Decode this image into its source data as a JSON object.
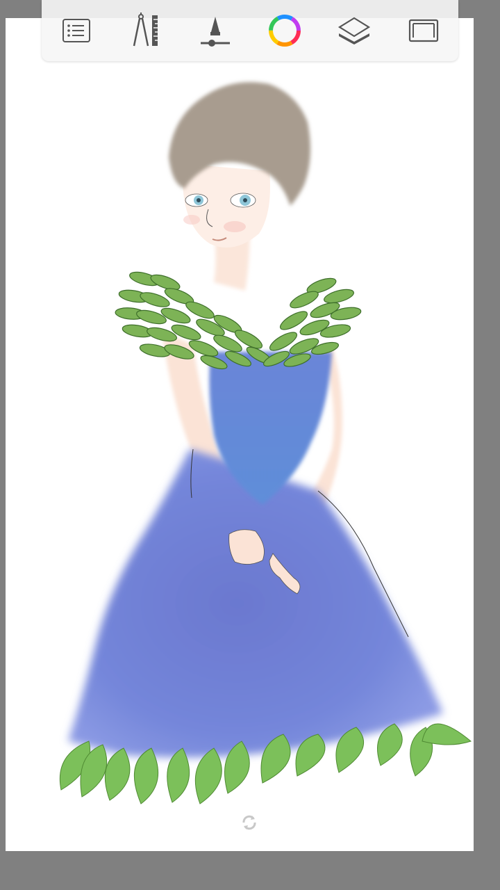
{
  "toolbar": {
    "items": [
      {
        "name": "list-icon",
        "tooltip": ""
      },
      {
        "name": "ruler-compass-icon",
        "tooltip": ""
      },
      {
        "name": "brush-size-icon",
        "tooltip": ""
      },
      {
        "name": "color-wheel-icon",
        "tooltip": ""
      },
      {
        "name": "layers-icon",
        "tooltip": ""
      },
      {
        "name": "fullscreen-icon",
        "tooltip": ""
      }
    ]
  },
  "colors": {
    "background": "#808080",
    "canvas": "#ffffff",
    "toolbar": "#f7f7f7",
    "icon": "#555555",
    "dress": "#6e7fd6",
    "leaf": "#7bbf52",
    "hair": "#a69a8c",
    "skin": "#fbe3d6"
  },
  "canvas": {
    "artwork": "illustration"
  },
  "status": {
    "sync_icon": "refresh-icon"
  }
}
